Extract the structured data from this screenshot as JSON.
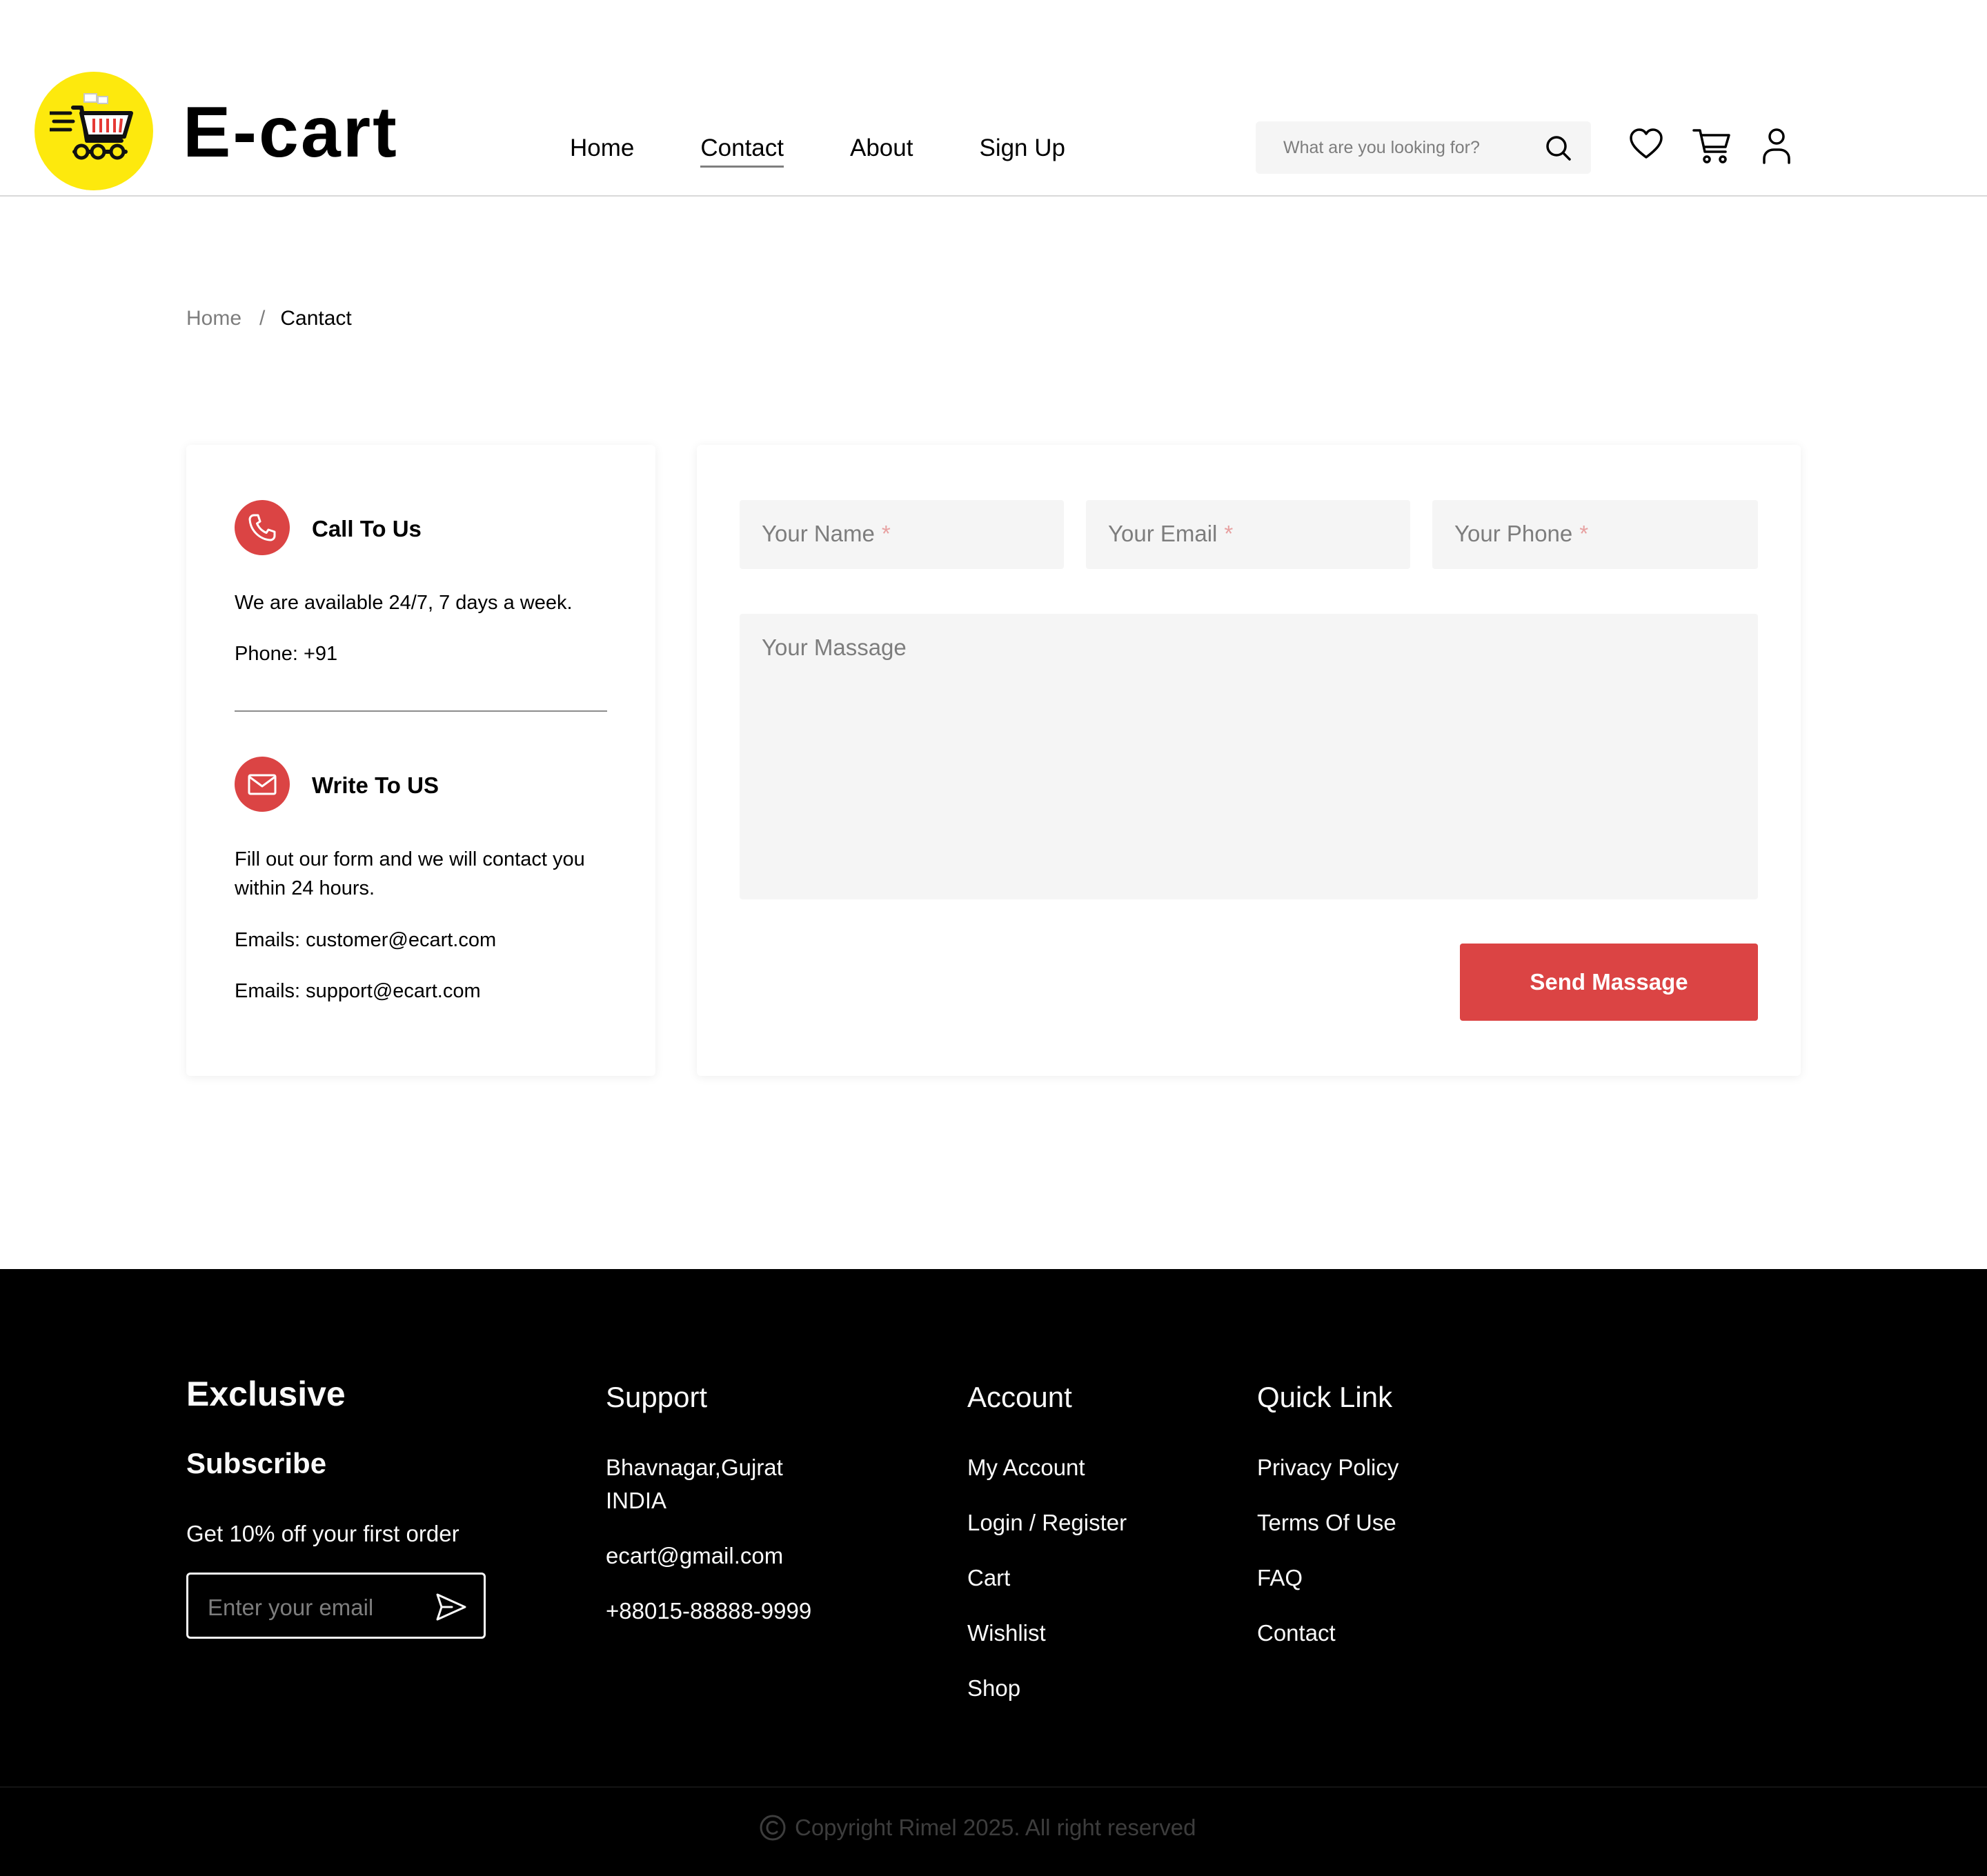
{
  "header": {
    "brand": "E-cart",
    "logo_icon": "shopping-cart-logo-icon",
    "nav": [
      {
        "label": "Home",
        "active": false
      },
      {
        "label": "Contact",
        "active": true
      },
      {
        "label": "About",
        "active": false
      },
      {
        "label": "Sign Up",
        "active": false
      }
    ],
    "search_placeholder": "What are you looking for?",
    "icons": [
      "search-icon",
      "heart-icon",
      "cart-icon",
      "user-icon"
    ]
  },
  "breadcrumb": {
    "home": "Home",
    "separator": "/",
    "current": "Cantact"
  },
  "info": {
    "call": {
      "title": "Call To Us",
      "text": "We are available 24/7, 7 days a week.",
      "phone": "Phone: +91"
    },
    "write": {
      "title": "Write To US",
      "text": "Fill out our form and we will contact you within 24 hours.",
      "email1": "Emails: customer@ecart.com",
      "email2": "Emails: support@ecart.com"
    }
  },
  "form": {
    "name_placeholder": "Your Name",
    "email_placeholder": "Your Email",
    "phone_placeholder": "Your Phone",
    "required_mark": "*",
    "message_placeholder": "Your Massage",
    "send_label": "Send Massage"
  },
  "footer": {
    "brand": "Exclusive",
    "subscribe_title": "Subscribe",
    "subscribe_text": "Get 10% off your first order",
    "subscribe_placeholder": "Enter your email",
    "support": {
      "title": "Support",
      "address_line1": "Bhavnagar,Gujrat",
      "address_line2": "INDIA",
      "email": "ecart@gmail.com",
      "phone": "+88015-88888-9999"
    },
    "account": {
      "title": "Account",
      "items": [
        "My Account",
        "Login / Register",
        "Cart",
        "Wishlist",
        "Shop"
      ]
    },
    "quick_link": {
      "title": "Quick Link",
      "items": [
        "Privacy Policy",
        "Terms Of Use",
        "FAQ",
        "Contact"
      ]
    },
    "copyright": "Copyright Rimel 2025. All right reserved"
  },
  "colors": {
    "accent": "#db4444",
    "logo_yellow": "#fde90d",
    "field_bg": "#f5f5f5",
    "footer_bg": "#000000"
  }
}
